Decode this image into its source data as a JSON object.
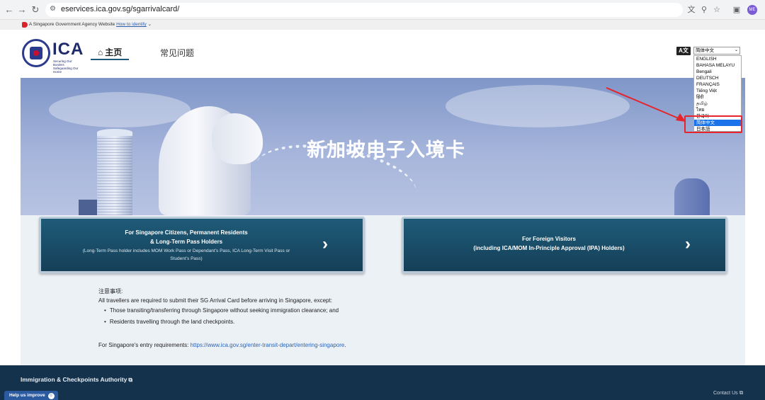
{
  "browser": {
    "url": "eservices.ica.gov.sg/sgarrivalcard/",
    "profile_initials": "ME"
  },
  "gov_strip": {
    "text": "A Singapore Government Agency Website",
    "link": "How to identify"
  },
  "header": {
    "logo": "ICA",
    "logo_sub": "Securing Our Borders Safeguarding Our Home",
    "nav_home": "主页",
    "nav_faq": "常见问题",
    "lang_icon": "A文",
    "lang_selected": "简体中文"
  },
  "language_list": [
    "ENGLISH",
    "BAHASA MELAYU",
    "Bengali",
    "DEUTSCH",
    "FRANÇAIS",
    "Tiếng Việt",
    "हिंदी",
    "தமிழ்",
    "ไทย",
    "한국어",
    "简体中文",
    "日本語"
  ],
  "language_list_selected_index": 10,
  "hero": {
    "title": "新加坡电子入境卡"
  },
  "cards": {
    "residents": {
      "title_line1": "For Singapore Citizens, Permanent Residents",
      "title_line2": "& Long-Term Pass Holders",
      "note_line1": "(Long-Term Pass holder includes MOM Work Pass or Dependant’s Pass, ICA Long-Term Visit Pass or",
      "note_line2": "Student’s Pass)"
    },
    "visitors": {
      "title_line1": "For Foreign Visitors",
      "title_line2": "(including ICA/MOM In-Principle Approval (IPA) Holders)"
    }
  },
  "notes": {
    "title": "注意事项:",
    "intro": "All travellers are required to submit their SG Arrival Card before arriving in Singapore, except:",
    "items": [
      "Those transiting/transferring through Singapore without seeking immigration clearance; and",
      "Residents travelling through the land checkpoints."
    ],
    "entry_prefix": "For Singapore's entry requirements: ",
    "entry_link": "https://www.ica.gov.sg/enter-transit-depart/entering-singapore",
    "entry_suffix": "."
  },
  "footer": {
    "authority": "Immigration & Checkpoints Authority",
    "contact": "Contact Us",
    "help": "Help us improve"
  },
  "colors": {
    "card_bg": "#1e5b78",
    "footer_bg": "#15324d",
    "highlight": "#e5242b",
    "link": "#2a63b6"
  }
}
